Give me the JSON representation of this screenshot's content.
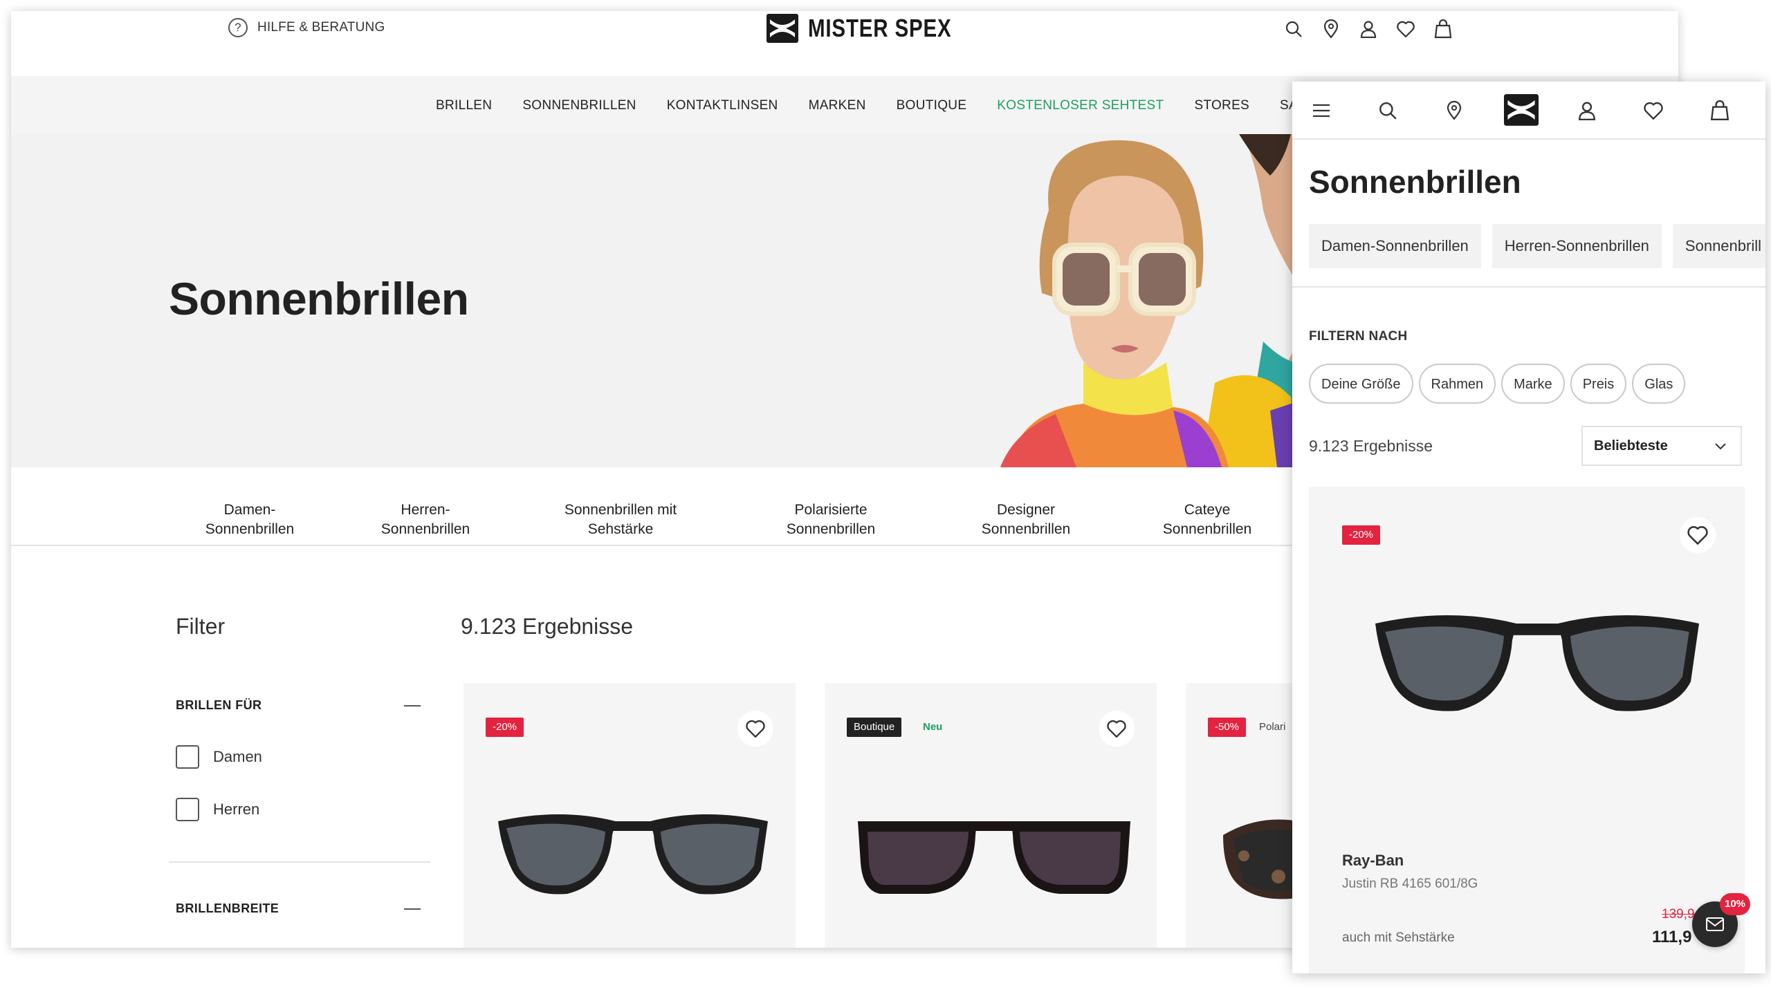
{
  "desktop": {
    "help_label": "HILFE & BERATUNG",
    "logo_text": "MISTER SPEX",
    "nav": [
      "BRILLEN",
      "SONNENBRILLEN",
      "KONTAKTLINSEN",
      "MARKEN",
      "BOUTIQUE",
      "KOSTENLOSER SEHTEST",
      "STORES",
      "SALE"
    ],
    "nav_highlight_color": "#1f9e63",
    "hero_title": "Sonnenbrillen",
    "subcategories": [
      {
        "line1": "Damen-",
        "line2": "Sonnenbrillen"
      },
      {
        "line1": "Herren-",
        "line2": "Sonnenbrillen"
      },
      {
        "line1": "Sonnenbrillen mit",
        "line2": "Sehstärke"
      },
      {
        "line1": "Polarisierte",
        "line2": "Sonnenbrillen"
      },
      {
        "line1": "Designer",
        "line2": "Sonnenbrillen"
      },
      {
        "line1": "Cateye",
        "line2": "Sonnenbrillen"
      }
    ],
    "filter_title": "Filter",
    "results_count": "9.123 Ergebnisse",
    "filter_sections": {
      "brillen_fuer": {
        "label": "BRILLEN FÜR",
        "options": [
          "Damen",
          "Herren"
        ]
      },
      "brillenbreite": {
        "label": "BRILLENBREITE"
      }
    },
    "products": [
      {
        "badges": [
          "-20%"
        ]
      },
      {
        "badges": [
          "Boutique",
          "Neu"
        ]
      },
      {
        "badges": [
          "-50%",
          "Polari"
        ]
      }
    ]
  },
  "mobile": {
    "title": "Sonnenbrillen",
    "chips": [
      "Damen-Sonnenbrillen",
      "Herren-Sonnenbrillen",
      "Sonnenbrill"
    ],
    "filter_label": "FILTERN NACH",
    "filters": [
      "Deine Größe",
      "Rahmen",
      "Marke",
      "Preis",
      "Glas"
    ],
    "results_count": "9.123 Ergebnisse",
    "sort_value": "Beliebteste",
    "product": {
      "badge": "-20%",
      "brand": "Ray-Ban",
      "model": "Justin RB 4165 601/8G",
      "note": "auch mit Sehstärke",
      "old_price": "139,9",
      "price": "111,9",
      "promo_badge": "10%"
    }
  },
  "colors": {
    "sale_red": "#e3233f",
    "accent_green": "#1f9e63"
  }
}
